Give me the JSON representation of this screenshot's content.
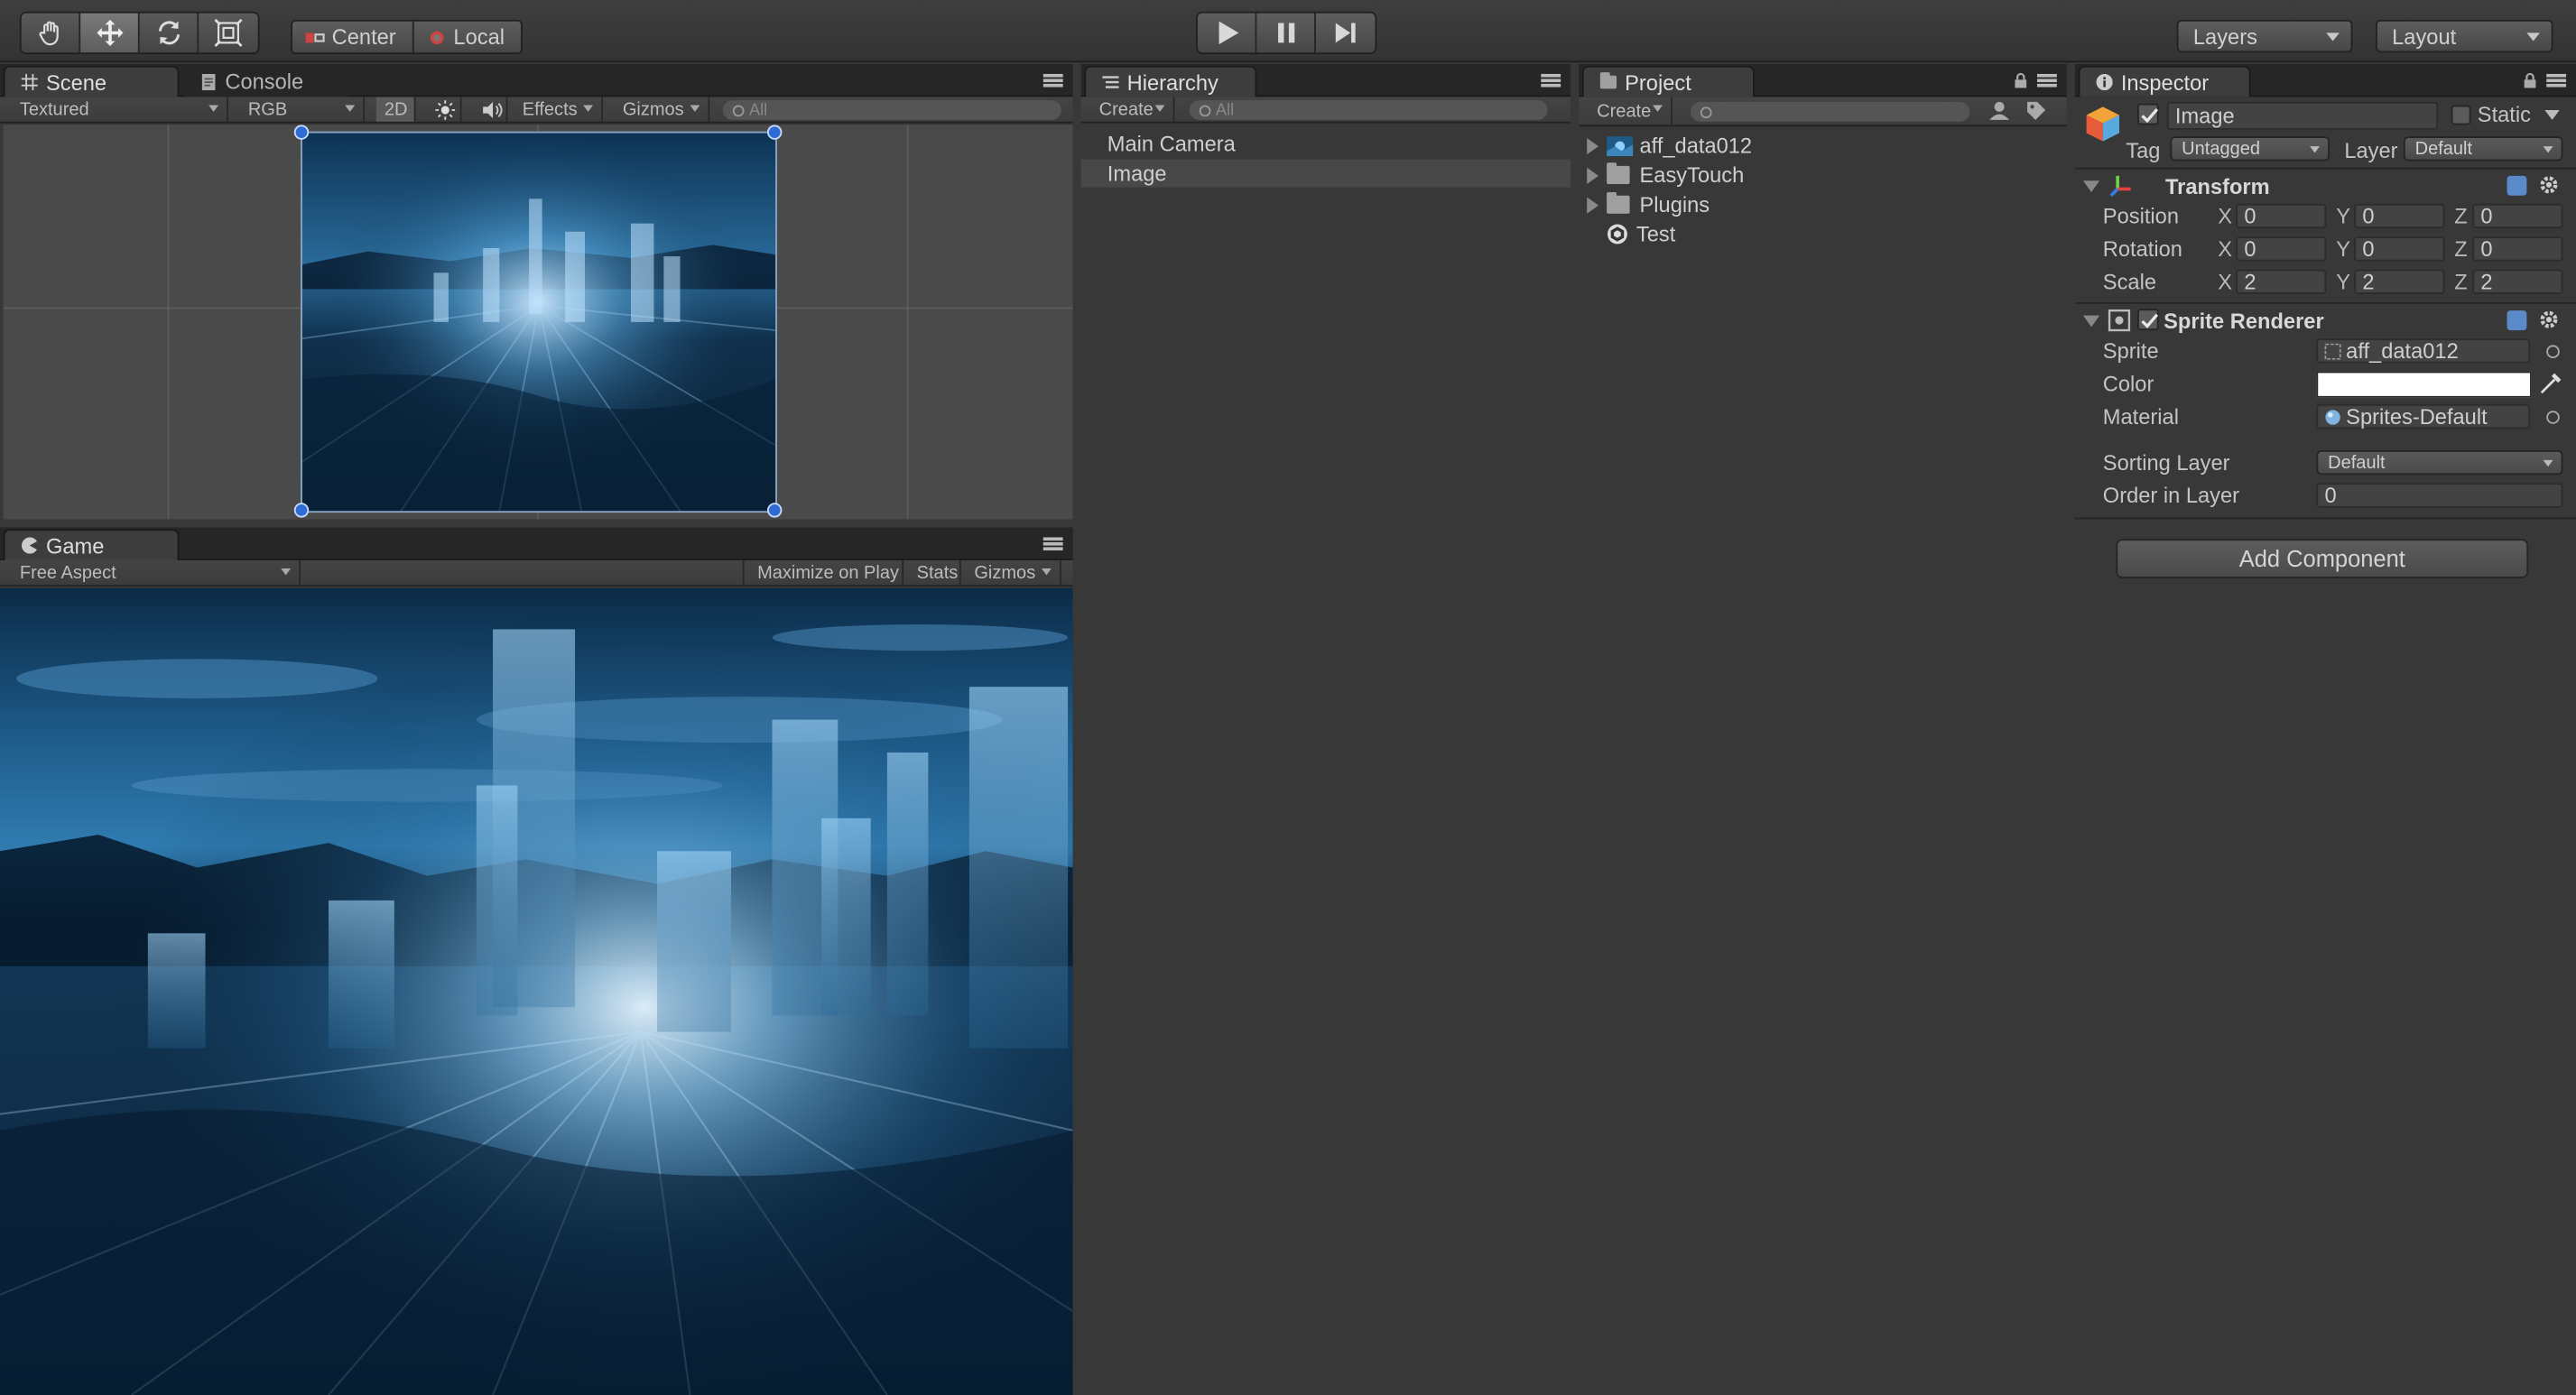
{
  "toolbar": {
    "pivot_center": "Center",
    "pivot_local": "Local",
    "layers": "Layers",
    "layout": "Layout"
  },
  "scene": {
    "tab_scene": "Scene",
    "tab_console": "Console",
    "draw_mode": "Textured",
    "render_mode": "RGB",
    "mode_2d": "2D",
    "effects": "Effects",
    "gizmos": "Gizmos",
    "search_placeholder": "All"
  },
  "game": {
    "tab": "Game",
    "aspect": "Free Aspect",
    "maximize": "Maximize on Play",
    "stats": "Stats",
    "gizmos": "Gizmos"
  },
  "hierarchy": {
    "tab": "Hierarchy",
    "create": "Create",
    "search_placeholder": "All",
    "items": [
      {
        "label": "Main Camera",
        "selected": false
      },
      {
        "label": "Image",
        "selected": true
      }
    ]
  },
  "project": {
    "tab": "Project",
    "create": "Create",
    "items": [
      {
        "label": "aff_data012",
        "icon": "image-asset-icon"
      },
      {
        "label": "EasyTouch",
        "icon": "folder-icon"
      },
      {
        "label": "Plugins",
        "icon": "folder-icon"
      },
      {
        "label": "Test",
        "icon": "unity-scene-icon"
      }
    ]
  },
  "inspector": {
    "tab": "Inspector",
    "object_name": "Image",
    "static_label": "Static",
    "tag_label": "Tag",
    "tag_value": "Untagged",
    "layer_label": "Layer",
    "layer_value": "Default",
    "transform": {
      "title": "Transform",
      "position_label": "Position",
      "rotation_label": "Rotation",
      "scale_label": "Scale",
      "position": {
        "x": "0",
        "y": "0",
        "z": "0"
      },
      "rotation": {
        "x": "0",
        "y": "0",
        "z": "0"
      },
      "scale": {
        "x": "2",
        "y": "2",
        "z": "2"
      }
    },
    "sprite_renderer": {
      "title": "Sprite Renderer",
      "sprite_label": "Sprite",
      "sprite_value": "aff_data012",
      "color_label": "Color",
      "color_value": "#ffffff",
      "material_label": "Material",
      "material_value": "Sprites-Default",
      "sorting_layer_label": "Sorting Layer",
      "sorting_layer_value": "Default",
      "order_label": "Order in Layer",
      "order_value": "0"
    },
    "add_component": "Add Component"
  },
  "axis_labels": {
    "x": "X",
    "y": "Y",
    "z": "Z"
  },
  "colors": {
    "handle": "#2f6bd3",
    "selection_highlight": "#484848",
    "help_icon": "#5b8ac8"
  }
}
